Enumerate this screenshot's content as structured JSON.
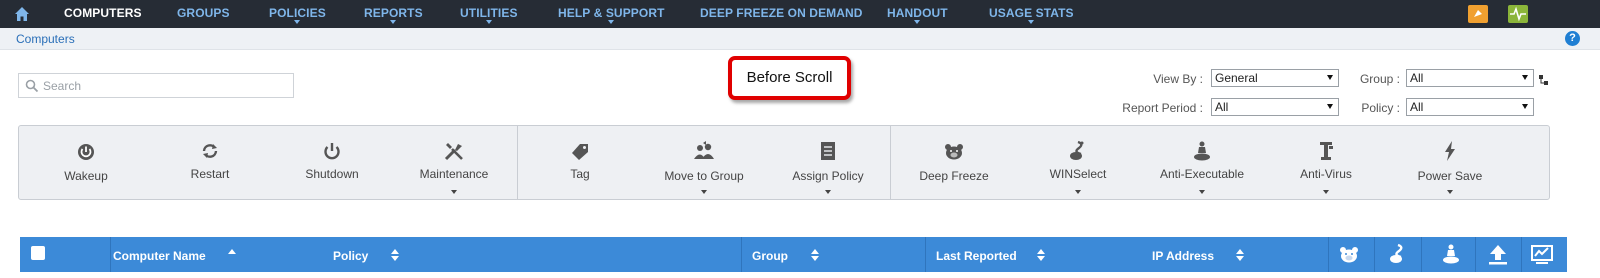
{
  "nav": {
    "items": [
      {
        "label": "COMPUTERS",
        "active": true,
        "dropdown": false
      },
      {
        "label": "GROUPS",
        "active": false,
        "dropdown": false
      },
      {
        "label": "POLICIES",
        "active": false,
        "dropdown": true
      },
      {
        "label": "REPORTS",
        "active": false,
        "dropdown": true
      },
      {
        "label": "UTILITIES",
        "active": false,
        "dropdown": true
      },
      {
        "label": "HELP & SUPPORT",
        "active": false,
        "dropdown": true
      },
      {
        "label": "DEEP FREEZE ON DEMAND",
        "active": false,
        "dropdown": false
      },
      {
        "label": "HANDOUT",
        "active": false,
        "dropdown": true
      },
      {
        "label": "USAGE STATS",
        "active": false,
        "dropdown": true
      }
    ],
    "icons": [
      "home-icon",
      "notification-icon",
      "activity-icon"
    ]
  },
  "breadcrumb": {
    "label": "Computers"
  },
  "search": {
    "placeholder": "Search",
    "value": ""
  },
  "callout": {
    "text": "Before Scroll"
  },
  "filters": {
    "view_by": {
      "label": "View By :",
      "value": "General"
    },
    "group": {
      "label": "Group :",
      "value": "All"
    },
    "report_period": {
      "label": "Report Period :",
      "value": "All"
    },
    "policy": {
      "label": "Policy :",
      "value": "All"
    }
  },
  "toolbar": {
    "tools": [
      {
        "label": "Wakeup",
        "icon": "power-icon",
        "dropdown": false
      },
      {
        "label": "Restart",
        "icon": "restart-icon",
        "dropdown": false
      },
      {
        "label": "Shutdown",
        "icon": "shutdown-icon",
        "dropdown": false
      },
      {
        "label": "Maintenance",
        "icon": "tools-icon",
        "dropdown": true
      },
      {
        "label": "Tag",
        "icon": "tag-icon",
        "dropdown": false
      },
      {
        "label": "Move to Group",
        "icon": "group-move-icon",
        "dropdown": true
      },
      {
        "label": "Assign Policy",
        "icon": "policy-icon",
        "dropdown": true
      },
      {
        "label": "Deep Freeze",
        "icon": "bear-icon",
        "dropdown": false
      },
      {
        "label": "WINSelect",
        "icon": "winselect-icon",
        "dropdown": true
      },
      {
        "label": "Anti-Executable",
        "icon": "anti-executable-icon",
        "dropdown": true
      },
      {
        "label": "Anti-Virus",
        "icon": "anti-virus-icon",
        "dropdown": true
      },
      {
        "label": "Power Save",
        "icon": "lightning-icon",
        "dropdown": true
      }
    ]
  },
  "table": {
    "columns": [
      "Computer Name",
      "Policy",
      "Group",
      "Last Reported",
      "IP Address"
    ],
    "sorted_column": "Computer Name",
    "icon_columns": [
      "deep-freeze-icon",
      "winselect-icon",
      "anti-executable-icon",
      "upload-icon",
      "monitor-icon"
    ]
  },
  "colors": {
    "nav_bg": "#262c35",
    "nav_link": "#7fb6ea",
    "header_bg": "#3c8ad8",
    "callout_border": "#e00000",
    "notification": "#f0a030",
    "activity": "#8bb53a"
  }
}
